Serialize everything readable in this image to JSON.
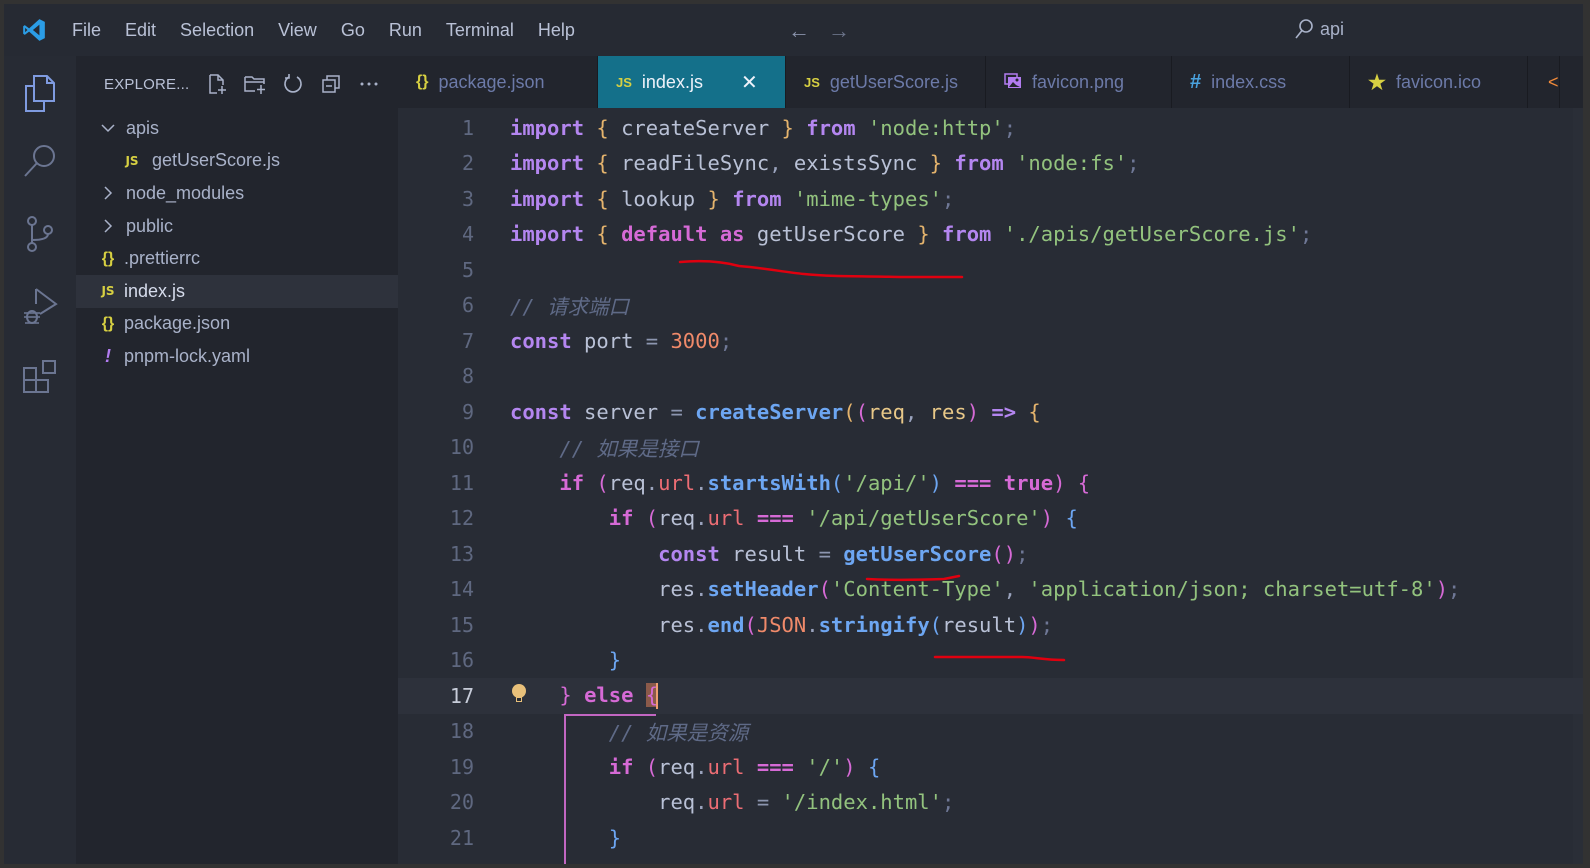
{
  "menu": [
    "File",
    "Edit",
    "Selection",
    "View",
    "Go",
    "Run",
    "Terminal",
    "Help"
  ],
  "search": {
    "text": "api",
    "icon": "search-icon"
  },
  "nav": {
    "back": "←",
    "forward": "→"
  },
  "activity_bar": [
    "explorer-icon",
    "search-icon",
    "source-control-icon",
    "run-debug-icon",
    "extensions-icon"
  ],
  "explorer": {
    "title": "EXPLORE...",
    "actions": [
      "new-file-icon",
      "new-folder-icon",
      "refresh-icon",
      "collapse-all-icon",
      "more-icon"
    ],
    "tree": [
      {
        "label": "apis",
        "type": "folder",
        "expanded": true,
        "depth": 0
      },
      {
        "label": "getUserScore.js",
        "type": "js",
        "depth": 1
      },
      {
        "label": "node_modules",
        "type": "folder",
        "expanded": false,
        "depth": 0
      },
      {
        "label": "public",
        "type": "folder",
        "expanded": false,
        "depth": 0
      },
      {
        "label": ".prettierrc",
        "type": "json",
        "depth": 0
      },
      {
        "label": "index.js",
        "type": "js",
        "depth": 0,
        "selected": true
      },
      {
        "label": "package.json",
        "type": "json",
        "depth": 0
      },
      {
        "label": "pnpm-lock.yaml",
        "type": "yaml",
        "depth": 0
      }
    ]
  },
  "tabs": [
    {
      "label": "package.json",
      "icon": "{}",
      "icon_color": "#d7d042",
      "active": false
    },
    {
      "label": "index.js",
      "icon": "JS",
      "icon_color": "#d7d042",
      "active": true,
      "close": "✕"
    },
    {
      "label": "getUserScore.js",
      "icon": "JS",
      "icon_color": "#d7d042",
      "active": false
    },
    {
      "label": "favicon.png",
      "icon": "image",
      "icon_color": "#b27cf0",
      "active": false
    },
    {
      "label": "index.css",
      "icon": "#",
      "icon_color": "#4aa3df",
      "active": false
    },
    {
      "label": "favicon.ico",
      "icon": "★",
      "icon_color": "#d7d042",
      "active": false
    }
  ],
  "editor": {
    "current_line": 17,
    "lines": [
      [
        [
          "kw",
          "import"
        ],
        [
          "p",
          " "
        ],
        [
          "br1",
          "{"
        ],
        [
          "p",
          " createServer "
        ],
        [
          "br1",
          "}"
        ],
        [
          "p",
          " "
        ],
        [
          "kw",
          "from"
        ],
        [
          "p",
          " "
        ],
        [
          "str",
          "'node:http'"
        ],
        [
          "semi",
          ";"
        ]
      ],
      [
        [
          "kw",
          "import"
        ],
        [
          "p",
          " "
        ],
        [
          "br1",
          "{"
        ],
        [
          "p",
          " readFileSync"
        ],
        [
          "punc",
          ","
        ],
        [
          "p",
          " existsSync "
        ],
        [
          "br1",
          "}"
        ],
        [
          "p",
          " "
        ],
        [
          "kw",
          "from"
        ],
        [
          "p",
          " "
        ],
        [
          "str",
          "'node:fs'"
        ],
        [
          "semi",
          ";"
        ]
      ],
      [
        [
          "kw",
          "import"
        ],
        [
          "p",
          " "
        ],
        [
          "br1",
          "{"
        ],
        [
          "p",
          " lookup "
        ],
        [
          "br1",
          "}"
        ],
        [
          "p",
          " "
        ],
        [
          "kw",
          "from"
        ],
        [
          "p",
          " "
        ],
        [
          "str",
          "'mime-types'"
        ],
        [
          "semi",
          ";"
        ]
      ],
      [
        [
          "kw",
          "import"
        ],
        [
          "p",
          " "
        ],
        [
          "br1",
          "{"
        ],
        [
          "p",
          " "
        ],
        [
          "kw2",
          "default"
        ],
        [
          "p",
          " "
        ],
        [
          "kw2",
          "as"
        ],
        [
          "p",
          " getUserScore "
        ],
        [
          "br1",
          "}"
        ],
        [
          "p",
          " "
        ],
        [
          "kw",
          "from"
        ],
        [
          "p",
          " "
        ],
        [
          "str",
          "'./apis/getUserScore.js'"
        ],
        [
          "semi",
          ";"
        ]
      ],
      [],
      [
        [
          "cmt",
          "// 请求端口"
        ]
      ],
      [
        [
          "kw",
          "const"
        ],
        [
          "p",
          " port "
        ],
        [
          "op",
          "="
        ],
        [
          "p",
          " "
        ],
        [
          "num",
          "3000"
        ],
        [
          "semi",
          ";"
        ]
      ],
      [],
      [
        [
          "kw",
          "const"
        ],
        [
          "p",
          " server "
        ],
        [
          "op",
          "="
        ],
        [
          "p",
          " "
        ],
        [
          "fn",
          "createServer"
        ],
        [
          "br1",
          "("
        ],
        [
          "br2",
          "("
        ],
        [
          "param",
          "req"
        ],
        [
          "punc",
          ","
        ],
        [
          "p",
          " "
        ],
        [
          "param",
          "res"
        ],
        [
          "br2",
          ")"
        ],
        [
          "p",
          " "
        ],
        [
          "kw",
          "=>"
        ],
        [
          "p",
          " "
        ],
        [
          "br1",
          "{"
        ]
      ],
      [
        [
          "p",
          "    "
        ],
        [
          "cmt",
          "// 如果是接口"
        ]
      ],
      [
        [
          "p",
          "    "
        ],
        [
          "kw2",
          "if"
        ],
        [
          "p",
          " "
        ],
        [
          "br2",
          "("
        ],
        [
          "p",
          "req"
        ],
        [
          "punc",
          "."
        ],
        [
          "prop",
          "url"
        ],
        [
          "punc",
          "."
        ],
        [
          "fn",
          "startsWith"
        ],
        [
          "br3",
          "("
        ],
        [
          "str",
          "'/api/'"
        ],
        [
          "br3",
          ")"
        ],
        [
          "p",
          " "
        ],
        [
          "kw2",
          "==="
        ],
        [
          "p",
          " "
        ],
        [
          "kw2",
          "true"
        ],
        [
          "br2",
          ")"
        ],
        [
          "p",
          " "
        ],
        [
          "br2",
          "{"
        ]
      ],
      [
        [
          "p",
          "        "
        ],
        [
          "kw2",
          "if"
        ],
        [
          "p",
          " "
        ],
        [
          "br2",
          "("
        ],
        [
          "p",
          "req"
        ],
        [
          "punc",
          "."
        ],
        [
          "prop",
          "url"
        ],
        [
          "p",
          " "
        ],
        [
          "kw2",
          "==="
        ],
        [
          "p",
          " "
        ],
        [
          "str",
          "'/api/getUserScore'"
        ],
        [
          "br2",
          ")"
        ],
        [
          "p",
          " "
        ],
        [
          "br3",
          "{"
        ]
      ],
      [
        [
          "p",
          "            "
        ],
        [
          "kw",
          "const"
        ],
        [
          "p",
          " result "
        ],
        [
          "op",
          "="
        ],
        [
          "p",
          " "
        ],
        [
          "fn",
          "getUserScore"
        ],
        [
          "br2",
          "()"
        ],
        [
          "semi",
          ";"
        ]
      ],
      [
        [
          "p",
          "            res"
        ],
        [
          "punc",
          "."
        ],
        [
          "fn",
          "setHeader"
        ],
        [
          "br2",
          "("
        ],
        [
          "str",
          "'Content-Type'"
        ],
        [
          "punc",
          ","
        ],
        [
          "p",
          " "
        ],
        [
          "str",
          "'application/json; charset=utf-8'"
        ],
        [
          "br2",
          ")"
        ],
        [
          "semi",
          ";"
        ]
      ],
      [
        [
          "p",
          "            res"
        ],
        [
          "punc",
          "."
        ],
        [
          "fn",
          "end"
        ],
        [
          "br2",
          "("
        ],
        [
          "obj",
          "JSON"
        ],
        [
          "punc",
          "."
        ],
        [
          "fn",
          "stringify"
        ],
        [
          "br3",
          "("
        ],
        [
          "p",
          "result"
        ],
        [
          "br3",
          ")"
        ],
        [
          "br2",
          ")"
        ],
        [
          "semi",
          ";"
        ]
      ],
      [
        [
          "p",
          "        "
        ],
        [
          "br3",
          "}"
        ]
      ],
      [
        [
          "p",
          "    "
        ],
        [
          "br2",
          "}"
        ],
        [
          "p",
          " "
        ],
        [
          "kw2",
          "else"
        ],
        [
          "p",
          " "
        ],
        [
          "cur",
          "{"
        ]
      ],
      [
        [
          "p",
          "        "
        ],
        [
          "cmt",
          "// 如果是资源"
        ]
      ],
      [
        [
          "p",
          "        "
        ],
        [
          "kw2",
          "if"
        ],
        [
          "p",
          " "
        ],
        [
          "br2",
          "("
        ],
        [
          "p",
          "req"
        ],
        [
          "punc",
          "."
        ],
        [
          "prop",
          "url"
        ],
        [
          "p",
          " "
        ],
        [
          "kw2",
          "==="
        ],
        [
          "p",
          " "
        ],
        [
          "str",
          "'/'"
        ],
        [
          "br2",
          ")"
        ],
        [
          "p",
          " "
        ],
        [
          "br3",
          "{"
        ]
      ],
      [
        [
          "p",
          "            req"
        ],
        [
          "punc",
          "."
        ],
        [
          "prop",
          "url"
        ],
        [
          "p",
          " "
        ],
        [
          "op",
          "="
        ],
        [
          "p",
          " "
        ],
        [
          "str",
          "'/index.html'"
        ],
        [
          "semi",
          ";"
        ]
      ],
      [
        [
          "p",
          "        "
        ],
        [
          "br3",
          "}"
        ]
      ]
    ]
  },
  "annotation_color": "#e0000f"
}
